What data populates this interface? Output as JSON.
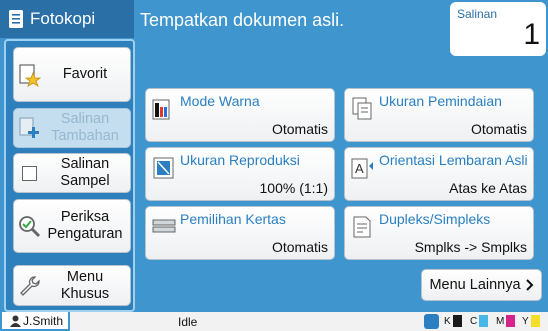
{
  "header": {
    "title": "Fotokopi",
    "message": "Tempatkan dokumen asli.",
    "copies_label": "Salinan",
    "copies_value": "1"
  },
  "sidebar": {
    "items": [
      {
        "label": "Favorit",
        "enabled": true
      },
      {
        "label": "Salinan Tambahan",
        "enabled": false
      },
      {
        "label": "Salinan Sampel",
        "enabled": true
      },
      {
        "label": "Periksa Pengaturan",
        "enabled": true
      },
      {
        "label": "Menu Khusus",
        "enabled": true
      }
    ]
  },
  "functions": [
    {
      "name": "Mode Warna",
      "value": "Otomatis"
    },
    {
      "name": "Ukuran Pemindaian",
      "value": "Otomatis"
    },
    {
      "name": "Ukuran Reproduksi",
      "value": "100% (1:1)"
    },
    {
      "name": "Orientasi Lembaran Asli",
      "value": "Atas ke Atas"
    },
    {
      "name": "Pemilihan Kertas",
      "value": "Otomatis"
    },
    {
      "name": "Dupleks/Simpleks",
      "value": "Smplks -> Smplks"
    }
  ],
  "more_button": {
    "label": "Menu Lainnya"
  },
  "status": {
    "user": "J.Smith",
    "state": "Idle",
    "inks": [
      {
        "letter": "K",
        "color": "#1a1a1a"
      },
      {
        "letter": "C",
        "color": "#46b7e6"
      },
      {
        "letter": "M",
        "color": "#d6248a"
      },
      {
        "letter": "Y",
        "color": "#f3df2a"
      }
    ]
  },
  "colors": {
    "accent": "#3f96cf",
    "title_tab": "#2b6fa7",
    "function_name": "#2b7fc1"
  }
}
